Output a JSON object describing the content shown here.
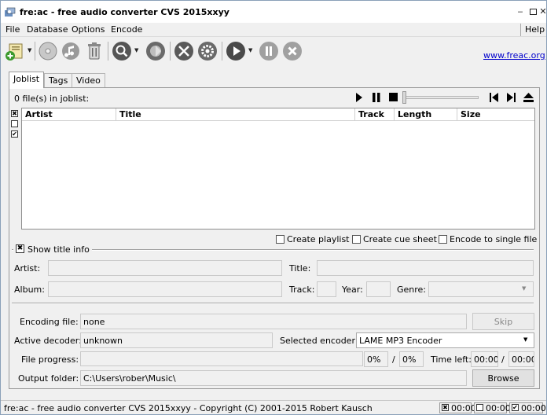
{
  "window": {
    "title": "fre:ac - free audio converter CVS 2015xxyy"
  },
  "menu": {
    "file": "File",
    "database": "Database",
    "options": "Options",
    "encode": "Encode",
    "help": "Help"
  },
  "toolbar": {
    "weblink": "www.freac.org"
  },
  "tabs": {
    "joblist": "Joblist",
    "tags": "Tags",
    "video": "Video"
  },
  "joblist": {
    "count_text": "0 file(s) in joblist:",
    "columns": [
      "Artist",
      "Title",
      "Track",
      "Length",
      "Size"
    ]
  },
  "options": {
    "create_playlist": "Create playlist",
    "create_cue_sheet": "Create cue sheet",
    "encode_single": "Encode to single file"
  },
  "title_info": {
    "show_label": "Show title info",
    "artist_label": "Artist:",
    "title_label": "Title:",
    "album_label": "Album:",
    "track_label": "Track:",
    "year_label": "Year:",
    "genre_label": "Genre:"
  },
  "encoding": {
    "file_label": "Encoding file:",
    "file_value": "none",
    "skip_label": "Skip",
    "decoder_label": "Active decoder:",
    "decoder_value": "unknown",
    "encoder_label": "Selected encoder:",
    "encoder_value": "LAME MP3 Encoder",
    "progress_label": "File progress:",
    "progress_pct1": "0%",
    "progress_slash": "/",
    "progress_pct2": "0%",
    "time_left_label": "Time left:",
    "time_left1": "00:00",
    "time_left_slash": "/",
    "time_left2": "00:00",
    "output_label": "Output folder:",
    "output_value": "C:\\Users\\rober\\Music\\",
    "browse_label": "Browse"
  },
  "status": {
    "text": "fre:ac - free audio converter CVS 2015xxyy - Copyright (C) 2001-2015 Robert Kausch",
    "t1": "00:00",
    "t2": "00:00",
    "t3": "00:00"
  }
}
